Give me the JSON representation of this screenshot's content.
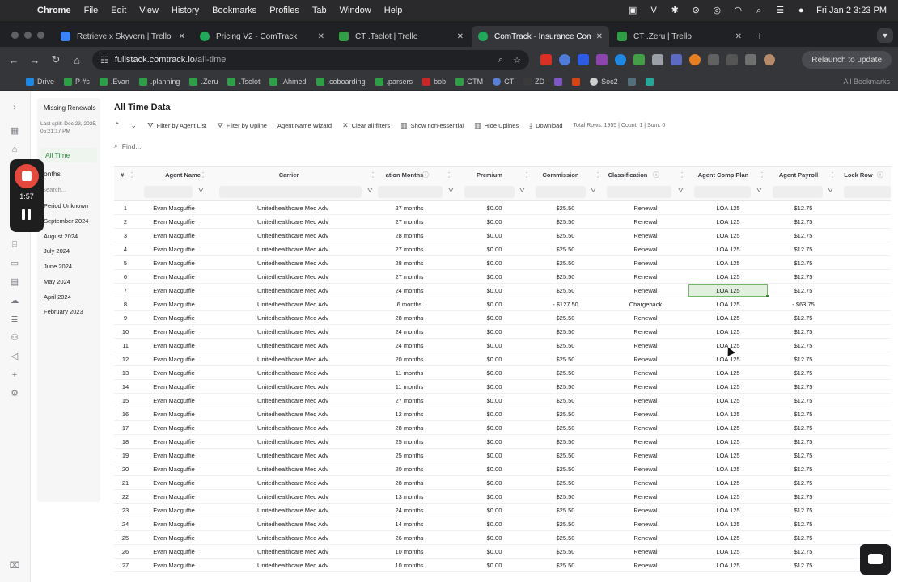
{
  "menubar": {
    "app": "Chrome",
    "items": [
      "File",
      "Edit",
      "View",
      "History",
      "Bookmarks",
      "Profiles",
      "Tab",
      "Window",
      "Help"
    ],
    "clock": "Fri Jan 2  3:23 PM"
  },
  "tabs": [
    {
      "title": "Retrieve x Skyvern | Trello",
      "color": "#3b82f6"
    },
    {
      "title": "Pricing V2 - ComTrack",
      "color": "#22a85a"
    },
    {
      "title": "CT .Tselot | Trello",
      "color": "#2f9e44"
    },
    {
      "title": "ComTrack - Insurance Commi",
      "color": "#22a85a"
    },
    {
      "title": "CT .Zeru | Trello",
      "color": "#2f9e44"
    }
  ],
  "address": {
    "host": "fullstack.comtrack.io",
    "path": "/all-time"
  },
  "toolbar": {
    "relaunch": "Relaunch to update"
  },
  "bookmarks": [
    "Drive",
    "P #s",
    ".Evan",
    ".planning",
    ".Zeru",
    ".Tselot",
    ".Ahmed",
    ".coboarding",
    ".parsers",
    "bob",
    "GTM",
    "CT",
    "ZD",
    "Soc2"
  ],
  "bookmarks_all": "All Bookmarks",
  "recorder": {
    "time": "1:57"
  },
  "period_panel": {
    "title": "Missing Renewals",
    "last_split": "Last split: Dec 23, 2025, 05:21:17 PM",
    "all_time": "All Time",
    "months_label": "onths",
    "search_placeholder": "Search...",
    "items": [
      "Period Unknown",
      "September 2024",
      "August 2024",
      "July 2024",
      "June 2024",
      "May 2024",
      "April 2024",
      "February 2023"
    ]
  },
  "page": {
    "title": "All Time Data",
    "actions": {
      "filter_agent": "Filter by Agent List",
      "filter_upline": "Filter by Upline",
      "agent_wizard": "Agent Name Wizard",
      "clear_filters": "Clear all filters",
      "show_nonessential": "Show non-essential",
      "hide_uplines": "Hide Uplines",
      "download": "Download"
    },
    "summary": "Total Rows: 1955 | Count: 1 | Sum: 0",
    "find_placeholder": "Find..."
  },
  "grid": {
    "columns": {
      "num": "#",
      "agent": "Agent Name",
      "carrier": "Carrier",
      "duration": "ation Months",
      "premium": "Premium",
      "commission": "Commission",
      "classification": "Classification",
      "comp_plan": "Agent Comp Plan",
      "payroll": "Agent Payroll",
      "lock": "Lock Row"
    },
    "rows": [
      {
        "n": "1",
        "agent": "Evan Macguffie",
        "carrier": "Unitedhealthcare Med Adv",
        "months": "27 months",
        "premium": "$0.00",
        "commission": "$25.50",
        "class": "Renewal",
        "plan": "LOA 125",
        "payroll": "$12.75"
      },
      {
        "n": "2",
        "agent": "Evan Macguffie",
        "carrier": "Unitedhealthcare Med Adv",
        "months": "27 months",
        "premium": "$0.00",
        "commission": "$25.50",
        "class": "Renewal",
        "plan": "LOA 125",
        "payroll": "$12.75"
      },
      {
        "n": "3",
        "agent": "Evan Macguffie",
        "carrier": "Unitedhealthcare Med Adv",
        "months": "28 months",
        "premium": "$0.00",
        "commission": "$25.50",
        "class": "Renewal",
        "plan": "LOA 125",
        "payroll": "$12.75"
      },
      {
        "n": "4",
        "agent": "Evan Macguffie",
        "carrier": "Unitedhealthcare Med Adv",
        "months": "27 months",
        "premium": "$0.00",
        "commission": "$25.50",
        "class": "Renewal",
        "plan": "LOA 125",
        "payroll": "$12.75"
      },
      {
        "n": "5",
        "agent": "Evan Macguffie",
        "carrier": "Unitedhealthcare Med Adv",
        "months": "28 months",
        "premium": "$0.00",
        "commission": "$25.50",
        "class": "Renewal",
        "plan": "LOA 125",
        "payroll": "$12.75"
      },
      {
        "n": "6",
        "agent": "Evan Macguffie",
        "carrier": "Unitedhealthcare Med Adv",
        "months": "27 months",
        "premium": "$0.00",
        "commission": "$25.50",
        "class": "Renewal",
        "plan": "LOA 125",
        "payroll": "$12.75"
      },
      {
        "n": "7",
        "agent": "Evan Macguffie",
        "carrier": "Unitedhealthcare Med Adv",
        "months": "24 months",
        "premium": "$0.00",
        "commission": "$25.50",
        "class": "Renewal",
        "plan": "LOA 125",
        "payroll": "$12.75",
        "selected": true
      },
      {
        "n": "8",
        "agent": "Evan Macguffie",
        "carrier": "Unitedhealthcare Med Adv",
        "months": "6 months",
        "premium": "$0.00",
        "commission": "- $127.50",
        "class": "Chargeback",
        "plan": "LOA 125",
        "payroll": "- $63.75"
      },
      {
        "n": "9",
        "agent": "Evan Macguffie",
        "carrier": "Unitedhealthcare Med Adv",
        "months": "28 months",
        "premium": "$0.00",
        "commission": "$25.50",
        "class": "Renewal",
        "plan": "LOA 125",
        "payroll": "$12.75"
      },
      {
        "n": "10",
        "agent": "Evan Macguffie",
        "carrier": "Unitedhealthcare Med Adv",
        "months": "24 months",
        "premium": "$0.00",
        "commission": "$25.50",
        "class": "Renewal",
        "plan": "LOA 125",
        "payroll": "$12.75"
      },
      {
        "n": "11",
        "agent": "Evan Macguffie",
        "carrier": "Unitedhealthcare Med Adv",
        "months": "24 months",
        "premium": "$0.00",
        "commission": "$25.50",
        "class": "Renewal",
        "plan": "LOA 125",
        "payroll": "$12.75"
      },
      {
        "n": "12",
        "agent": "Evan Macguffie",
        "carrier": "Unitedhealthcare Med Adv",
        "months": "20 months",
        "premium": "$0.00",
        "commission": "$25.50",
        "class": "Renewal",
        "plan": "LOA 125",
        "payroll": "$12.75"
      },
      {
        "n": "13",
        "agent": "Evan Macguffie",
        "carrier": "Unitedhealthcare Med Adv",
        "months": "11 months",
        "premium": "$0.00",
        "commission": "$25.50",
        "class": "Renewal",
        "plan": "LOA 125",
        "payroll": "$12.75"
      },
      {
        "n": "14",
        "agent": "Evan Macguffie",
        "carrier": "Unitedhealthcare Med Adv",
        "months": "11 months",
        "premium": "$0.00",
        "commission": "$25.50",
        "class": "Renewal",
        "plan": "LOA 125",
        "payroll": "$12.75"
      },
      {
        "n": "15",
        "agent": "Evan Macguffie",
        "carrier": "Unitedhealthcare Med Adv",
        "months": "27 months",
        "premium": "$0.00",
        "commission": "$25.50",
        "class": "Renewal",
        "plan": "LOA 125",
        "payroll": "$12.75"
      },
      {
        "n": "16",
        "agent": "Evan Macguffie",
        "carrier": "Unitedhealthcare Med Adv",
        "months": "12 months",
        "premium": "$0.00",
        "commission": "$25.50",
        "class": "Renewal",
        "plan": "LOA 125",
        "payroll": "$12.75"
      },
      {
        "n": "17",
        "agent": "Evan Macguffie",
        "carrier": "Unitedhealthcare Med Adv",
        "months": "28 months",
        "premium": "$0.00",
        "commission": "$25.50",
        "class": "Renewal",
        "plan": "LOA 125",
        "payroll": "$12.75"
      },
      {
        "n": "18",
        "agent": "Evan Macguffie",
        "carrier": "Unitedhealthcare Med Adv",
        "months": "25 months",
        "premium": "$0.00",
        "commission": "$25.50",
        "class": "Renewal",
        "plan": "LOA 125",
        "payroll": "$12.75"
      },
      {
        "n": "19",
        "agent": "Evan Macguffie",
        "carrier": "Unitedhealthcare Med Adv",
        "months": "25 months",
        "premium": "$0.00",
        "commission": "$25.50",
        "class": "Renewal",
        "plan": "LOA 125",
        "payroll": "$12.75"
      },
      {
        "n": "20",
        "agent": "Evan Macguffie",
        "carrier": "Unitedhealthcare Med Adv",
        "months": "20 months",
        "premium": "$0.00",
        "commission": "$25.50",
        "class": "Renewal",
        "plan": "LOA 125",
        "payroll": "$12.75"
      },
      {
        "n": "21",
        "agent": "Evan Macguffie",
        "carrier": "Unitedhealthcare Med Adv",
        "months": "28 months",
        "premium": "$0.00",
        "commission": "$25.50",
        "class": "Renewal",
        "plan": "LOA 125",
        "payroll": "$12.75"
      },
      {
        "n": "22",
        "agent": "Evan Macguffie",
        "carrier": "Unitedhealthcare Med Adv",
        "months": "13 months",
        "premium": "$0.00",
        "commission": "$25.50",
        "class": "Renewal",
        "plan": "LOA 125",
        "payroll": "$12.75"
      },
      {
        "n": "23",
        "agent": "Evan Macguffie",
        "carrier": "Unitedhealthcare Med Adv",
        "months": "24 months",
        "premium": "$0.00",
        "commission": "$25.50",
        "class": "Renewal",
        "plan": "LOA 125",
        "payroll": "$12.75"
      },
      {
        "n": "24",
        "agent": "Evan Macguffie",
        "carrier": "Unitedhealthcare Med Adv",
        "months": "14 months",
        "premium": "$0.00",
        "commission": "$25.50",
        "class": "Renewal",
        "plan": "LOA 125",
        "payroll": "$12.75"
      },
      {
        "n": "25",
        "agent": "Evan Macguffie",
        "carrier": "Unitedhealthcare Med Adv",
        "months": "26 months",
        "premium": "$0.00",
        "commission": "$25.50",
        "class": "Renewal",
        "plan": "LOA 125",
        "payroll": "$12.75"
      },
      {
        "n": "26",
        "agent": "Evan Macguffie",
        "carrier": "Unitedhealthcare Med Adv",
        "months": "10 months",
        "premium": "$0.00",
        "commission": "$25.50",
        "class": "Renewal",
        "plan": "LOA 125",
        "payroll": "$12.75"
      },
      {
        "n": "27",
        "agent": "Evan Macguffie",
        "carrier": "Unitedhealthcare Med Adv",
        "months": "10 months",
        "premium": "$0.00",
        "commission": "$25.50",
        "class": "Renewal",
        "plan": "LOA 125",
        "payroll": "$12.75"
      }
    ]
  }
}
